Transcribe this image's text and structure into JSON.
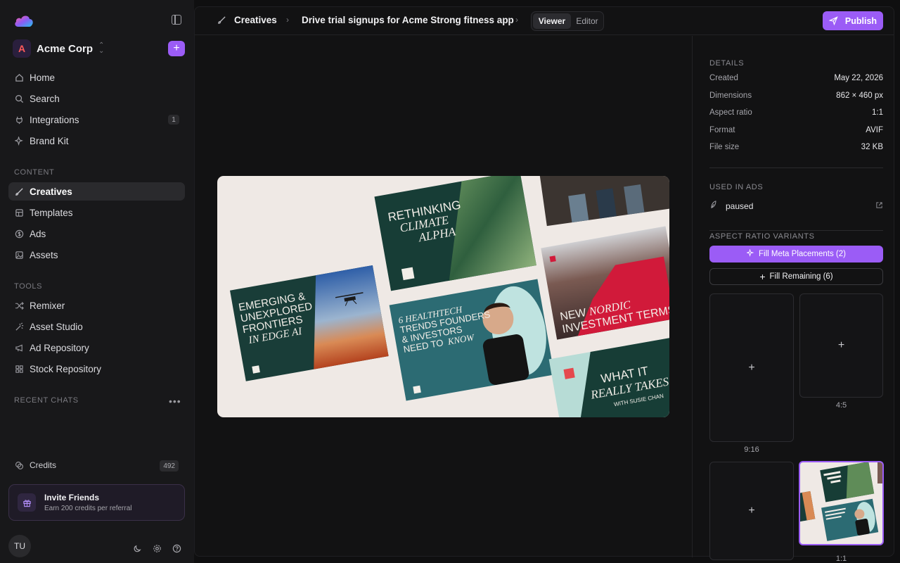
{
  "sidebar": {
    "workspace": {
      "initial": "A",
      "name": "Acme Corp"
    },
    "main_nav": [
      {
        "label": "Home",
        "icon": "home-icon"
      },
      {
        "label": "Search",
        "icon": "search-icon"
      },
      {
        "label": "Integrations",
        "icon": "plug-icon",
        "badge": "1"
      },
      {
        "label": "Brand Kit",
        "icon": "sparkle-icon"
      }
    ],
    "content_title": "CONTENT",
    "content_nav": [
      {
        "label": "Creatives",
        "icon": "brush-icon",
        "active": true
      },
      {
        "label": "Templates",
        "icon": "template-icon"
      },
      {
        "label": "Ads",
        "icon": "dollar-icon"
      },
      {
        "label": "Assets",
        "icon": "image-icon"
      }
    ],
    "tools_title": "TOOLS",
    "tools_nav": [
      {
        "label": "Remixer",
        "icon": "shuffle-icon"
      },
      {
        "label": "Asset Studio",
        "icon": "wand-icon"
      },
      {
        "label": "Ad Repository",
        "icon": "megaphone-icon"
      },
      {
        "label": "Stock Repository",
        "icon": "grid-icon"
      }
    ],
    "recent_chats_title": "RECENT CHATS",
    "credits": {
      "label": "Credits",
      "value": "492"
    },
    "invite": {
      "title": "Invite Friends",
      "subtitle": "Earn 200 credits per referral"
    },
    "user_initials": "TU"
  },
  "topbar": {
    "crumb_section": "Creatives",
    "crumb_title": "Drive trial signups for Acme Strong fitness app",
    "view_viewer": "Viewer",
    "view_editor": "Editor",
    "publish": "Publish"
  },
  "preview": {
    "card1": [
      "EMERGING &",
      "UNEXPLORED",
      "FRONTIERS"
    ],
    "card1_italic": "IN EDGE AI",
    "card2": "RETHINKING",
    "card2_italic": [
      "CLIMATE",
      "ALPHA"
    ],
    "card3_italic": "6 HEALTHTECH",
    "card3": [
      "TRENDS FOUNDERS",
      "& INVESTORS",
      "NEED TO"
    ],
    "card3_know": "KNOW",
    "card4": "NEW",
    "card4_italic": "NORDIC",
    "card4_b": "INVESTMENT TERMS",
    "card5": "WHAT IT",
    "card5_italic": "REALLY TAKES",
    "card5_sub": "WITH SUSIE CHAN",
    "mark": "/\\"
  },
  "details": {
    "title": "DETAILS",
    "rows": [
      {
        "key": "Created",
        "value": "May 22, 2026"
      },
      {
        "key": "Dimensions",
        "value": "862 × 460 px"
      },
      {
        "key": "Aspect ratio",
        "value": "1:1"
      },
      {
        "key": "Format",
        "value": "AVIF"
      },
      {
        "key": "File size",
        "value": "32 KB"
      }
    ]
  },
  "used_in_ads": {
    "title": "USED IN ADS",
    "status": "paused"
  },
  "variants": {
    "title": "ASPECT RATIO VARIANTS",
    "fill_meta": "Fill Meta Placements (2)",
    "fill_remaining": "Fill Remaining (6)",
    "labels": [
      "9:16",
      "4:5",
      "1:1"
    ],
    "plus": "+"
  },
  "colors": {
    "accent": "#9b5cf6",
    "background": "#0f0f10",
    "sidebar": "#18181a"
  }
}
